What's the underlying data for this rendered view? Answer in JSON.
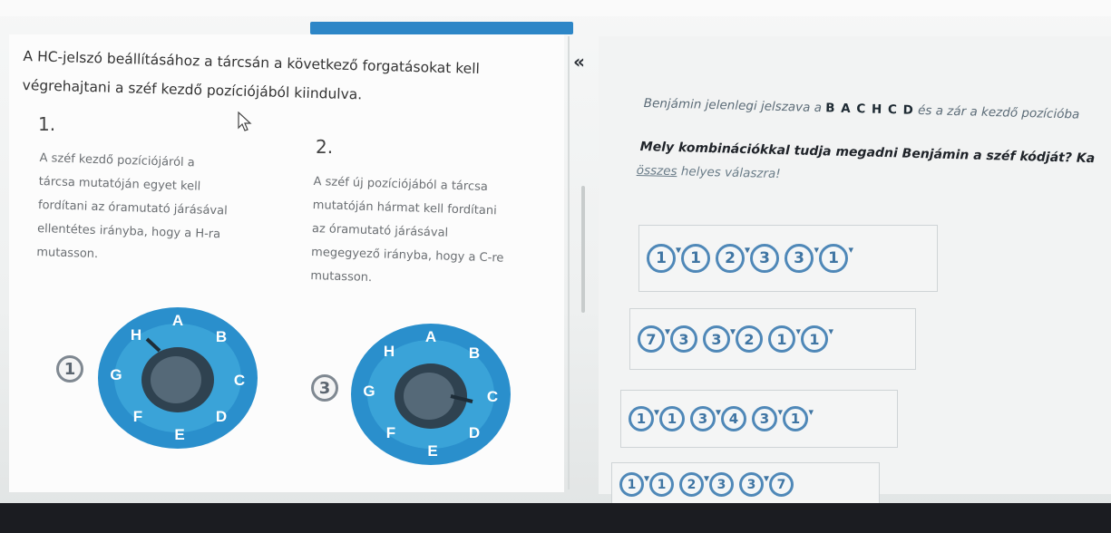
{
  "instructions": {
    "intro_line1": "A HC-jelszó beállításához a tárcsán a következő forgatásokat kell",
    "intro_line2": "végrehajtani a széf kezdő pozíciójából kiindulva.",
    "collapse_label": "«"
  },
  "steps": [
    {
      "number": "1.",
      "lines": [
        "A széf kezdő pozíciójáról a",
        "tárcsa mutatóján egyet kell",
        "fordítani az óramutató járásával",
        "ellentétes irányba, hogy a H-ra",
        "mutasson."
      ],
      "rotation_badge": "1",
      "pointer_letter": "H"
    },
    {
      "number": "2.",
      "lines": [
        "A széf új pozíciójából a tárcsa",
        "mutatóján hármat kell fordítani",
        "az óramutató járásával",
        "megegyező irányba, hogy a C-re",
        "mutasson."
      ],
      "rotation_badge": "3",
      "pointer_letter": "C"
    }
  ],
  "dial_letters": [
    "A",
    "B",
    "C",
    "D",
    "E",
    "F",
    "G",
    "H"
  ],
  "question": {
    "info_prefix": "Benjámin jelenlegi jelszava a ",
    "info_code": "B A C H C D",
    "info_suffix": " és a zár a kezdő pozícióba",
    "main": "Mely kombinációkkal tudja megadni Benjámin a széf kódját? Ka",
    "hint_underlined": "összes",
    "hint_rest": " helyes válaszra!"
  },
  "options": [
    {
      "badges": [
        "1",
        "1",
        "2",
        "3",
        "3",
        "1"
      ]
    },
    {
      "badges": [
        "7",
        "3",
        "3",
        "2",
        "1",
        "1"
      ]
    },
    {
      "badges": [
        "1",
        "1",
        "3",
        "4",
        "3",
        "1"
      ]
    },
    {
      "badges": [
        "1",
        "1",
        "2",
        "3",
        "3",
        "7"
      ]
    }
  ],
  "colors": {
    "accent_blue": "#2d86c7",
    "dial_blue": "#2a8fcc",
    "option_blue": "#4f88b8"
  }
}
